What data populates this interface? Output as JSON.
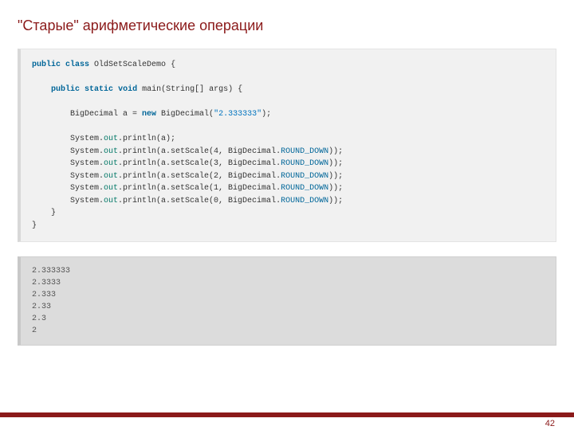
{
  "title": "\"Старые\" арифметические операции",
  "code": {
    "l1": {
      "kw1": "public",
      "kw2": "class",
      "rest": " OldSetScaleDemo {"
    },
    "l2": {
      "kw1": "public",
      "kw2": "static",
      "kw3": "void",
      "rest": " main(String[] args) {"
    },
    "l3": {
      "pre": "        BigDecimal a = ",
      "kw": "new",
      "mid": " BigDecimal(",
      "str": "\"2.333333\"",
      "post": ");"
    },
    "l4": {
      "pre": "        System.",
      "field": "out",
      "post": ".println(a);"
    },
    "l5": {
      "pre": "        System.",
      "field": "out",
      "mid": ".println(a.setScale(4, BigDecimal.",
      "enum": "ROUND_DOWN",
      "post": "));"
    },
    "l6": {
      "pre": "        System.",
      "field": "out",
      "mid": ".println(a.setScale(3, BigDecimal.",
      "enum": "ROUND_DOWN",
      "post": "));"
    },
    "l7": {
      "pre": "        System.",
      "field": "out",
      "mid": ".println(a.setScale(2, BigDecimal.",
      "enum": "ROUND_DOWN",
      "post": "));"
    },
    "l8": {
      "pre": "        System.",
      "field": "out",
      "mid": ".println(a.setScale(1, BigDecimal.",
      "enum": "ROUND_DOWN",
      "post": "));"
    },
    "l9": {
      "pre": "        System.",
      "field": "out",
      "mid": ".println(a.setScale(0, BigDecimal.",
      "enum": "ROUND_DOWN",
      "post": "));"
    },
    "l10": "    }",
    "l11": "}"
  },
  "output": "2.333333\n2.3333\n2.333\n2.33\n2.3\n2",
  "page_number": "42"
}
